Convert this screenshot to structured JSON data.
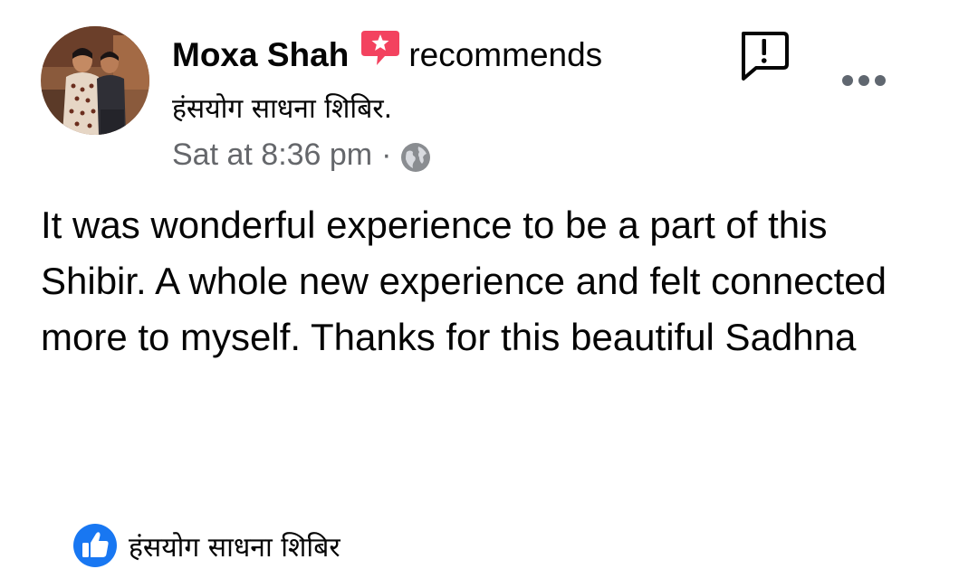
{
  "post": {
    "author": "Moxa Shah",
    "action": "recommends",
    "page_name": "हंसयोग साधना शिबिर.",
    "timestamp": "Sat at 8:36 pm",
    "separator": "·",
    "privacy_icon": "globe-icon",
    "body": "It was wonderful experience to be a part of this Shibir. A whole new experience and felt connected more to myself. Thanks for this beautiful Sadhna"
  },
  "footer": {
    "icon": "like-icon",
    "page_name": "हंसयोग साधना शिबिर"
  },
  "icons": {
    "recommend_badge": "recommend-star-icon",
    "report": "report-icon",
    "more": "more-options-icon"
  },
  "colors": {
    "recommend_badge": "#f3425f",
    "like_blue": "#1877f2",
    "secondary_text": "#65676b",
    "primary_text": "#050505"
  }
}
